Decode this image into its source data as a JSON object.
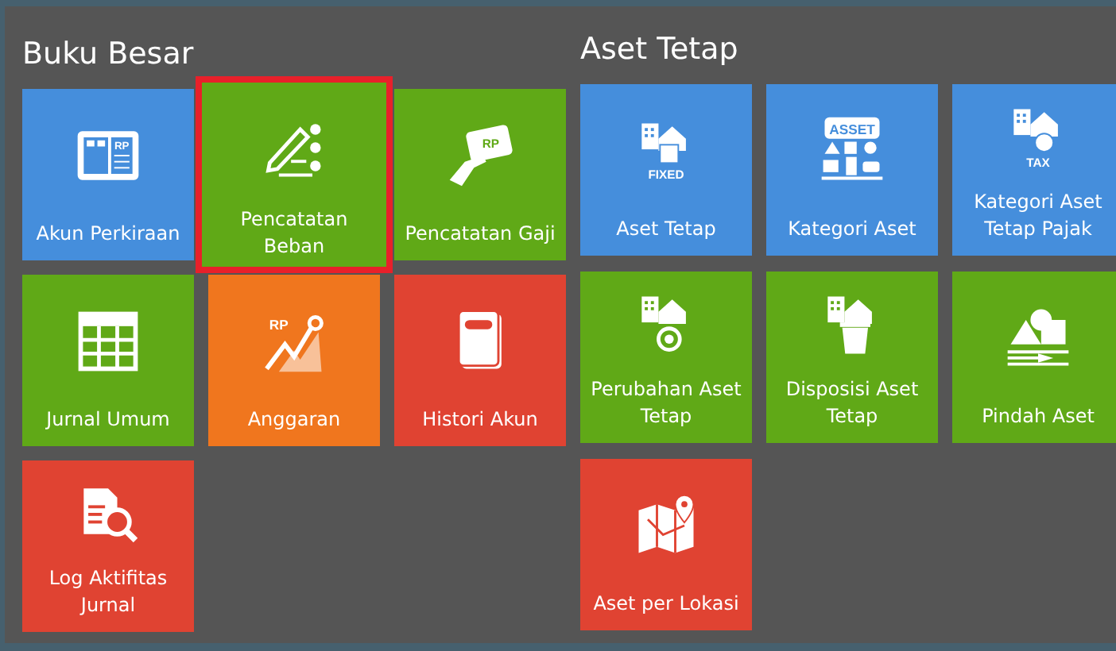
{
  "groups": [
    {
      "title": "Buku Besar",
      "tiles": [
        {
          "label": "Akun Perkiraan",
          "color": "#458edc",
          "selected": false,
          "icon_text": "RP"
        },
        {
          "label": "Pencatatan Beban",
          "color": "#60a917",
          "selected": true
        },
        {
          "label": "Pencatatan Gaji",
          "color": "#60a917",
          "selected": false,
          "icon_text": "RP"
        },
        {
          "label": "Jurnal Umum",
          "color": "#60a917",
          "selected": false
        },
        {
          "label": "Anggaran",
          "color": "#f0761e",
          "selected": false,
          "icon_text": "RP"
        },
        {
          "label": "Histori Akun",
          "color": "#e04332",
          "selected": false
        },
        {
          "label": "Log Aktifitas Jurnal",
          "color": "#e04332",
          "selected": false
        }
      ]
    },
    {
      "title": "Aset Tetap",
      "tiles": [
        {
          "label": "Aset Tetap",
          "color": "#458edc",
          "selected": false,
          "icon_text": "FIXED"
        },
        {
          "label": "Kategori Aset",
          "color": "#458edc",
          "selected": false,
          "icon_text": "ASSET"
        },
        {
          "label": "Kategori Aset Tetap Pajak",
          "color": "#458edc",
          "selected": false,
          "icon_text": "TAX"
        },
        {
          "label": "Perubahan Aset Tetap",
          "color": "#60a917",
          "selected": false
        },
        {
          "label": "Disposisi Aset Tetap",
          "color": "#60a917",
          "selected": false
        },
        {
          "label": "Pindah Aset",
          "color": "#60a917",
          "selected": false
        },
        {
          "label": "Aset per Lokasi",
          "color": "#e04332",
          "selected": false
        }
      ]
    }
  ]
}
